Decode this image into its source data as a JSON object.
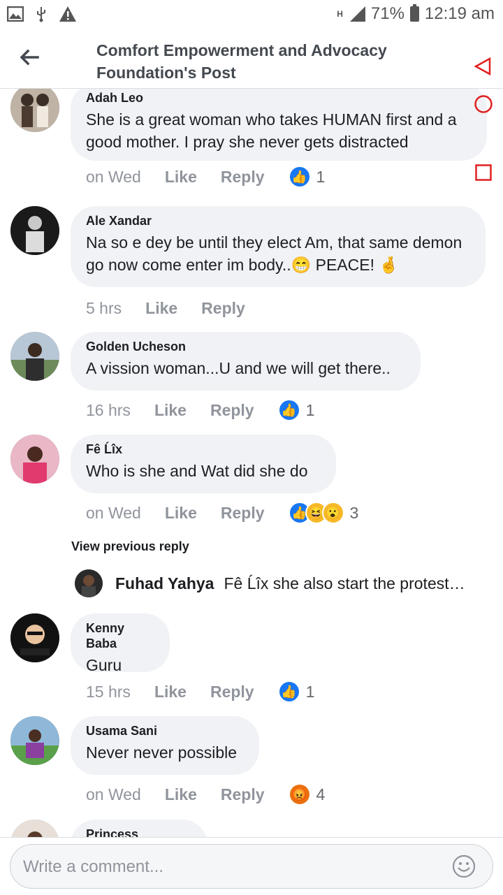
{
  "status_bar": {
    "network": "H",
    "battery": "71%",
    "time": "12:19 am"
  },
  "header": {
    "title": "Comfort Empowerment and Advocacy Foundation's Post"
  },
  "comments": [
    {
      "name": "Adah Leo",
      "text": "She is a great woman who takes HUMAN first and a good mother. I pray she never gets distracted",
      "time": "on Wed",
      "like": "Like",
      "reply": "Reply",
      "reaction_count": "1"
    },
    {
      "name": "Ale Xandar",
      "text": "Na so e dey be until they elect Am, that same demon go now come enter im body..😁 PEACE! 🤞",
      "time": "5 hrs",
      "like": "Like",
      "reply": "Reply"
    },
    {
      "name": "Golden Ucheson",
      "text": "A vission woman...U and we will get there..",
      "time": "16 hrs",
      "like": "Like",
      "reply": "Reply",
      "reaction_count": "1"
    },
    {
      "name": "Fê Ĺîx",
      "text": "Who is she and Wat did she do",
      "time": "on Wed",
      "like": "Like",
      "reply": "Reply",
      "reaction_count": "3"
    },
    {
      "name": "Kenny Baba",
      "text": "Guru",
      "time": "15 hrs",
      "like": "Like",
      "reply": "Reply",
      "reaction_count": "1"
    },
    {
      "name": "Usama Sani",
      "text": "Never never possible",
      "time": "on Wed",
      "like": "Like",
      "reply": "Reply",
      "reaction_count": "4"
    },
    {
      "name": "Princess Harishba"
    }
  ],
  "view_previous_reply": "View previous reply",
  "nested_reply": {
    "name": "Fuhad Yahya",
    "text": "Fê Ĺîx she also start the protest…"
  },
  "composer": {
    "placeholder": "Write a comment..."
  },
  "colors": {
    "accent": "#1877f2",
    "bubble": "#f0f2f5",
    "meta": "#90949c",
    "overlay_red": "#e02020"
  }
}
